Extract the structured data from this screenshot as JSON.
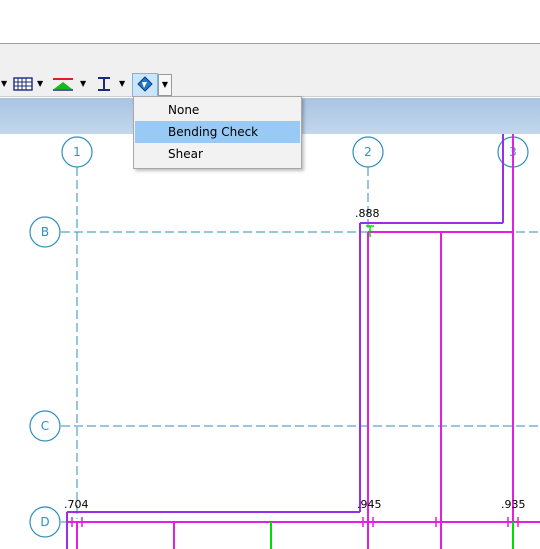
{
  "toolbar": {
    "tools": [
      {
        "icon": "hatch-pattern-icon"
      },
      {
        "icon": "load-line-icon"
      },
      {
        "icon": "i-beam-icon"
      },
      {
        "icon": "member-check-icon",
        "active": true
      }
    ]
  },
  "dropdown": {
    "items": [
      {
        "label": "None",
        "selected": false
      },
      {
        "label": "Bending Check",
        "selected": true
      },
      {
        "label": "Shear",
        "selected": false
      }
    ]
  },
  "grid": {
    "columns": [
      "1",
      "2",
      "3"
    ],
    "rows": [
      "B",
      "C",
      "D"
    ]
  },
  "ratios": {
    "top": ".888",
    "bottom_left": ".704",
    "bottom_mid": ".945",
    "bottom_right": ".935"
  },
  "colors": {
    "grid_line": "#2f8fbf",
    "member": "#e021e0",
    "member_alt": "#9a2ee6",
    "marker": "#00dd00"
  }
}
